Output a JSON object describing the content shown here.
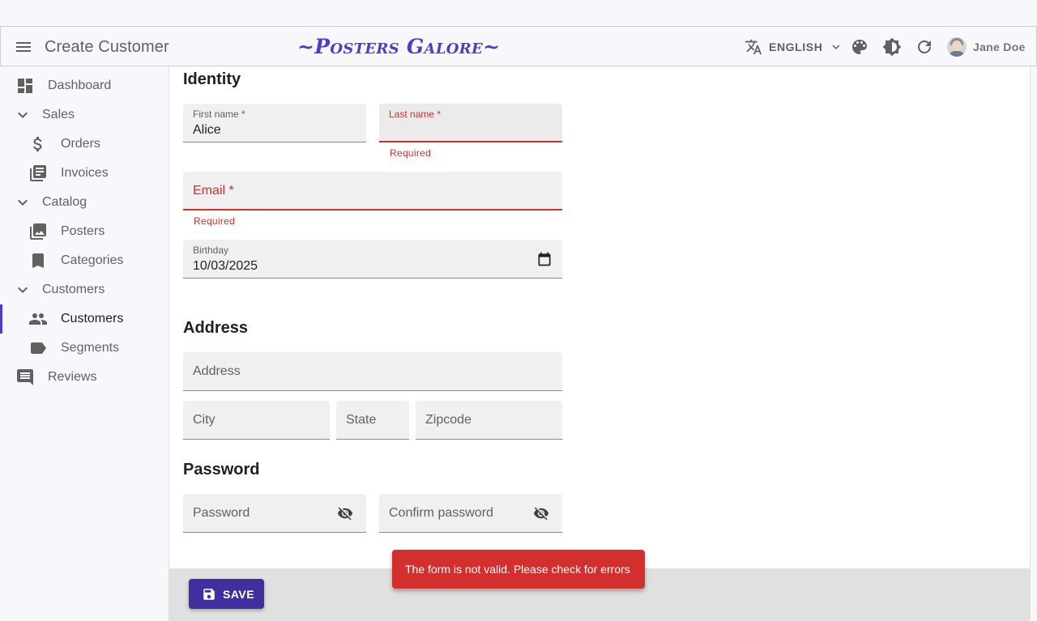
{
  "appbar": {
    "title": "Create Customer",
    "brand": "~Posters Galore~",
    "language": "ENGLISH",
    "user_name": "Jane Doe",
    "icons": [
      "menu-icon",
      "translate-icon",
      "chevron-down-icon",
      "palette-icon",
      "brightness-icon",
      "refresh-icon",
      "avatar"
    ]
  },
  "sidebar": {
    "items": [
      {
        "label": "Dashboard",
        "icon": "dashboard-icon"
      },
      {
        "label": "Sales",
        "icon": "chevron-down-icon"
      },
      {
        "label": "Orders",
        "icon": "dollar-icon"
      },
      {
        "label": "Invoices",
        "icon": "library-books-icon"
      },
      {
        "label": "Catalog",
        "icon": "chevron-down-icon"
      },
      {
        "label": "Posters",
        "icon": "collections-icon"
      },
      {
        "label": "Categories",
        "icon": "bookmark-icon"
      },
      {
        "label": "Customers",
        "icon": "chevron-down-icon"
      },
      {
        "label": "Customers",
        "icon": "people-icon",
        "active": true
      },
      {
        "label": "Segments",
        "icon": "label-icon"
      },
      {
        "label": "Reviews",
        "icon": "comment-icon"
      }
    ]
  },
  "form": {
    "identity_title": "Identity",
    "first_name_label": "First name *",
    "first_name_value": "Alice",
    "last_name_label": "Last name *",
    "last_name_error": "Required",
    "email_label": "Email *",
    "email_error": "Required",
    "birthday_label": "Birthday",
    "birthday_value": "10/03/2025",
    "address_title": "Address",
    "address_label": "Address",
    "city_label": "City",
    "state_label": "State",
    "zipcode_label": "Zipcode",
    "password_title": "Password",
    "password_label": "Password",
    "confirm_password_label": "Confirm password"
  },
  "toolbar": {
    "save_label": "SAVE"
  },
  "snackbar": {
    "message": "The form is not valid. Please check for errors"
  },
  "colors": {
    "accent": "#4f3cc9",
    "save_button": "#3f2f9f",
    "error": "#d32f2f"
  }
}
